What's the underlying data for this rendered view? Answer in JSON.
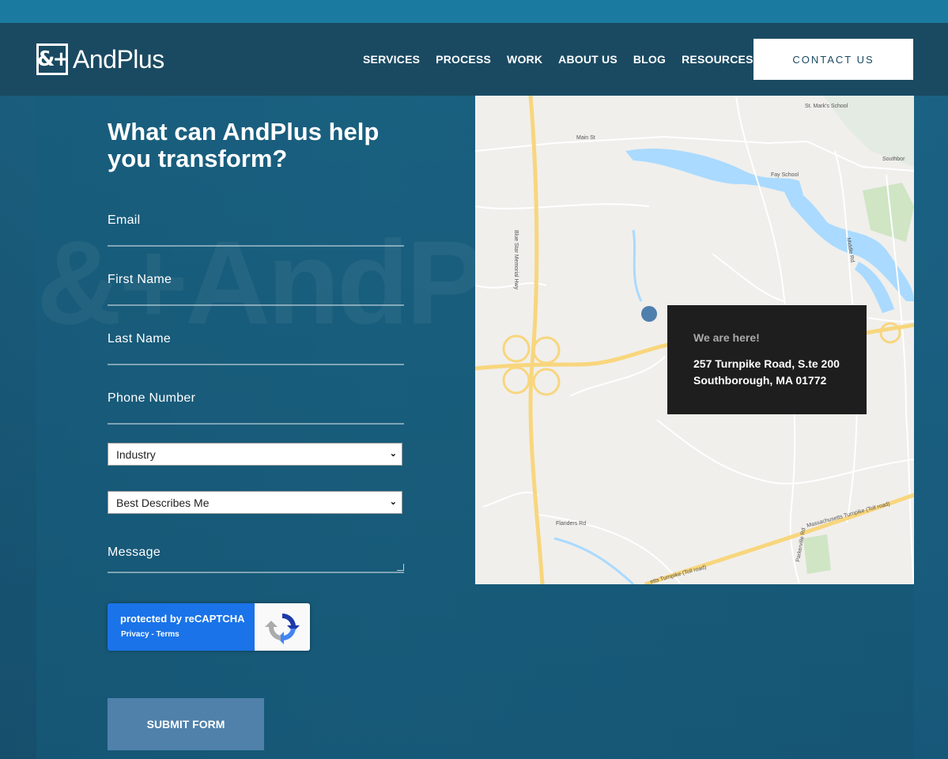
{
  "brand": {
    "logo_mark": "&+",
    "name": "AndPlus"
  },
  "nav": {
    "items": [
      "SERVICES",
      "PROCESS",
      "WORK",
      "ABOUT US",
      "BLOG",
      "RESOURCES"
    ],
    "contact_label": "CONTACT US"
  },
  "form": {
    "title": "What can AndPlus help you transform?",
    "fields": {
      "email": "Email",
      "first_name": "First Name",
      "last_name": "Last Name",
      "phone": "Phone Number",
      "message": "Message"
    },
    "selects": {
      "industry": "Industry",
      "describes": "Best Describes Me"
    },
    "recaptcha": {
      "line1": "protected by reCAPTCHA",
      "line2": "Privacy - Terms"
    },
    "submit_label": "SUBMIT FORM"
  },
  "map": {
    "info_heading": "We are here!",
    "address_line1": "257 Turnpike Road, S.te 200",
    "address_line2": "Southborough, MA 01772",
    "labels": {
      "st_marks": "St. Mark's School",
      "fay": "Fay School",
      "southborough": "Southbor",
      "main_st": "Main St",
      "mass_pike": "Massachusetts Turnpike (Toll road)",
      "mass_pike_lower": "etts Turnpike (Toll road)",
      "blue_star": "Blue Star Memorial Hwy",
      "flanders": "Flanders Rd",
      "middle": "Middle Rd",
      "parkerville": "Parkerville Rd"
    }
  },
  "colors": {
    "header": "#1a4a62",
    "accent_blue": "#4f81ab",
    "page_bg": "#1a5872"
  }
}
